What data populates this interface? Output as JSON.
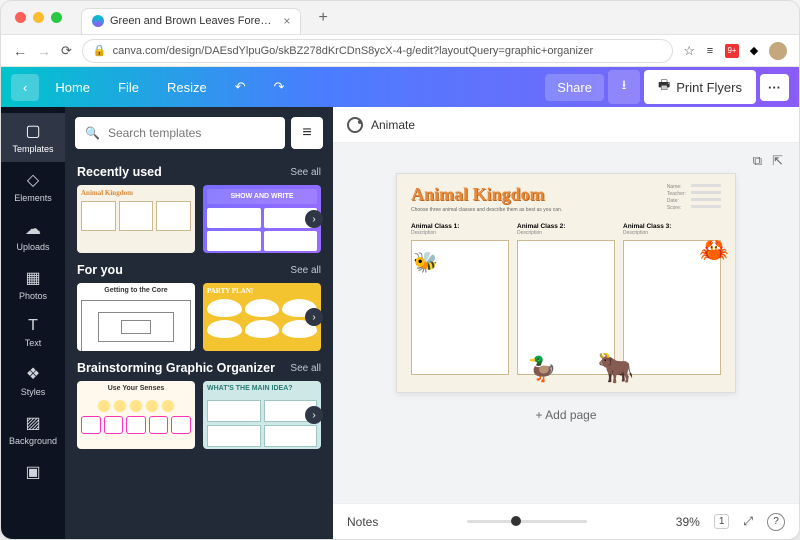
{
  "browser": {
    "tab_title": "Green and Brown Leaves Fore…",
    "new_tab_label": "+",
    "url": "canva.com/design/DAEsdYlpuGo/skBZ278dKrCDnS8ycX-4-g/edit?layoutQuery=graphic+organizer"
  },
  "topbar": {
    "back": "‹",
    "home": "Home",
    "file": "File",
    "resize": "Resize",
    "share": "Share",
    "print": "Print Flyers",
    "more": "···"
  },
  "rail": {
    "templates": "Templates",
    "elements": "Elements",
    "uploads": "Uploads",
    "photos": "Photos",
    "text": "Text",
    "styles": "Styles",
    "background": "Background"
  },
  "panel": {
    "search_placeholder": "Search templates",
    "see_all": "See all",
    "sections": {
      "recent": {
        "title": "Recently used",
        "thumb1": "Animal Kingdom",
        "thumb2": "SHOW AND WRITE"
      },
      "foryou": {
        "title": "For you",
        "thumb1": "Getting to the Core",
        "thumb2": "PARTY PLAN!"
      },
      "brainstorm": {
        "title": "Brainstorming Graphic Organizer",
        "thumb1": "Use Your Senses",
        "thumb2": "WHAT'S THE MAIN IDEA?"
      }
    }
  },
  "canvas": {
    "animate": "Animate",
    "page": {
      "title": "Animal Kingdom",
      "subtitle": "Choose three animal classes and describe them as best as you can.",
      "meta": {
        "name_label": "Name:",
        "teacher_label": "Teacher:",
        "date_label": "Date:",
        "score_label": "Score:"
      },
      "col1": "Animal Class 1:",
      "col2": "Animal Class 2:",
      "col3": "Animal Class 3:",
      "desc": "Description"
    },
    "add_page": "+ Add page"
  },
  "bottom": {
    "notes": "Notes",
    "zoom": "39%",
    "page_indicator": "1"
  }
}
